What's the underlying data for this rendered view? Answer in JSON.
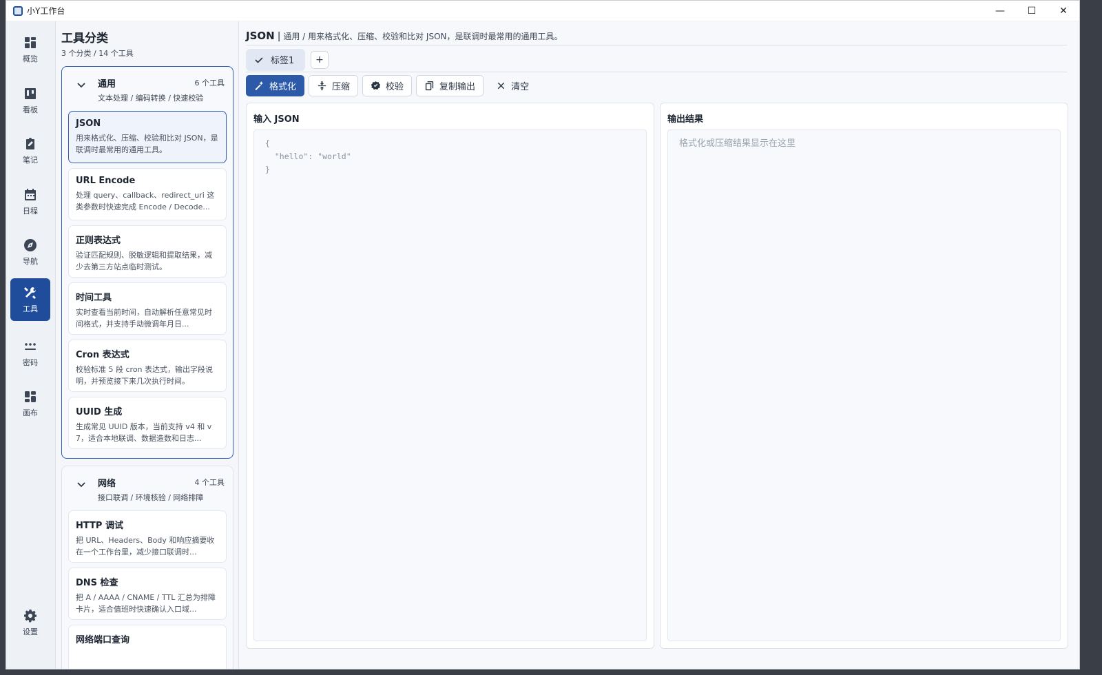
{
  "window": {
    "title": "小Y工作台",
    "controls": {
      "minimize": "—",
      "maximize": "☐",
      "close": "✕"
    }
  },
  "nav": [
    {
      "label": "概览",
      "icon": "dashboard-icon"
    },
    {
      "label": "看板",
      "icon": "kanban-icon"
    },
    {
      "label": "笔记",
      "icon": "note-icon"
    },
    {
      "label": "日程",
      "icon": "calendar-icon"
    },
    {
      "label": "导航",
      "icon": "compass-icon"
    },
    {
      "label": "工具",
      "icon": "tools-icon",
      "active": true
    },
    {
      "label": "密码",
      "icon": "password-icon"
    },
    {
      "label": "画布",
      "icon": "canvas-icon"
    },
    {
      "label": "设置",
      "icon": "gear-icon"
    }
  ],
  "categories": {
    "title": "工具分类",
    "summary": "3 个分类 / 14 个工具",
    "groups": [
      {
        "name": "通用",
        "count": "6 个工具",
        "desc": "文本处理 / 编码转换 / 快速校验",
        "tools": [
          {
            "name": "JSON",
            "desc": "用来格式化、压缩、校验和比对 JSON，是联调时最常用的通用工具。"
          },
          {
            "name": "URL Encode",
            "desc": "处理 query、callback、redirect_uri 这类参数时快速完成 Encode / Decode..."
          },
          {
            "name": "正则表达式",
            "desc": "验证匹配规则、脱敏逻辑和提取结果，减少去第三方站点临时测试。"
          },
          {
            "name": "时间工具",
            "desc": "实时查看当前时间，自动解析任意常见时间格式，并支持手动微调年月日..."
          },
          {
            "name": "Cron 表达式",
            "desc": "校验标准 5 段 cron 表达式，输出字段说明，并预览接下来几次执行时间。"
          },
          {
            "name": "UUID 生成",
            "desc": "生成常见 UUID 版本，当前支持 v4 和 v7，适合本地联调、数据造数和日志..."
          }
        ]
      },
      {
        "name": "网络",
        "count": "4 个工具",
        "desc": "接口联调 / 环境核验 / 网络排障",
        "tools": [
          {
            "name": "HTTP 调试",
            "desc": "把 URL、Headers、Body 和响应摘要收在一个工作台里，减少接口联调时..."
          },
          {
            "name": "DNS 检查",
            "desc": "把 A / AAAA / CNAME / TTL 汇总为排障卡片，适合值班时快速确认入口域..."
          },
          {
            "name": "网络端口查询",
            "desc": ""
          }
        ]
      }
    ]
  },
  "main": {
    "title": "JSON",
    "separator": "|",
    "desc": "通用 / 用来格式化、压缩、校验和比对 JSON，是联调时最常用的通用工具。",
    "tabs": [
      {
        "label": "标签1"
      }
    ],
    "add_tab": "+",
    "toolbar": {
      "format": "格式化",
      "compress": "压缩",
      "validate": "校验",
      "copy_output": "复制输出",
      "clear": "清空"
    },
    "input": {
      "title": "输入 JSON",
      "code": "{\n  \"hello\": \"world\"\n}"
    },
    "output": {
      "title": "输出结果",
      "placeholder": "格式化或压缩结果显示在这里"
    }
  },
  "colors": {
    "accent": "#1f4d9c",
    "primary_button": "#2c5aa8"
  }
}
